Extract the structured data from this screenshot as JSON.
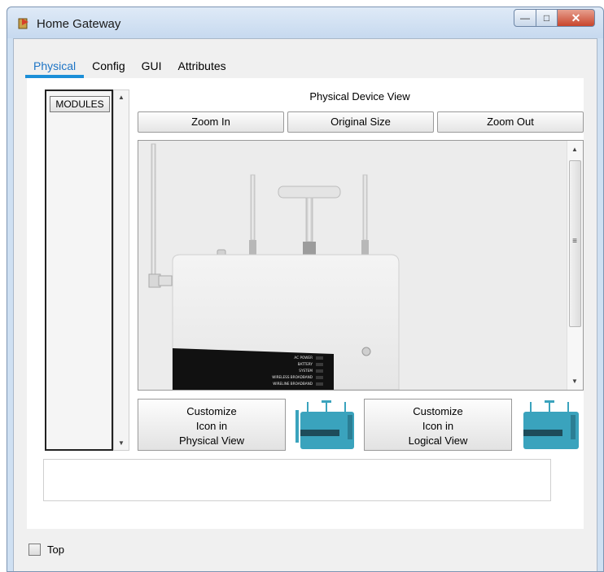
{
  "window": {
    "title": "Home Gateway"
  },
  "tabs": [
    {
      "label": "Physical",
      "active": true
    },
    {
      "label": "Config"
    },
    {
      "label": "GUI"
    },
    {
      "label": "Attributes"
    }
  ],
  "modules": {
    "button_label": "MODULES"
  },
  "physical_view": {
    "title": "Physical Device View",
    "zoom_in": "Zoom In",
    "original_size": "Original Size",
    "zoom_out": "Zoom Out"
  },
  "device_panel_labels": [
    "AC POWER",
    "BATTERY",
    "SYSTEM",
    "WIRELESS BROADBAND",
    "WIRELINE BROADBAND"
  ],
  "customize": {
    "physical": {
      "line1": "Customize",
      "line2": "Icon in",
      "line3": "Physical View"
    },
    "logical": {
      "line1": "Customize",
      "line2": "Icon in",
      "line3": "Logical View"
    }
  },
  "footer": {
    "top_label": "Top",
    "top_checked": false
  },
  "colors": {
    "accent": "#1c8fd8",
    "device_icon": "#3aa3bd"
  }
}
